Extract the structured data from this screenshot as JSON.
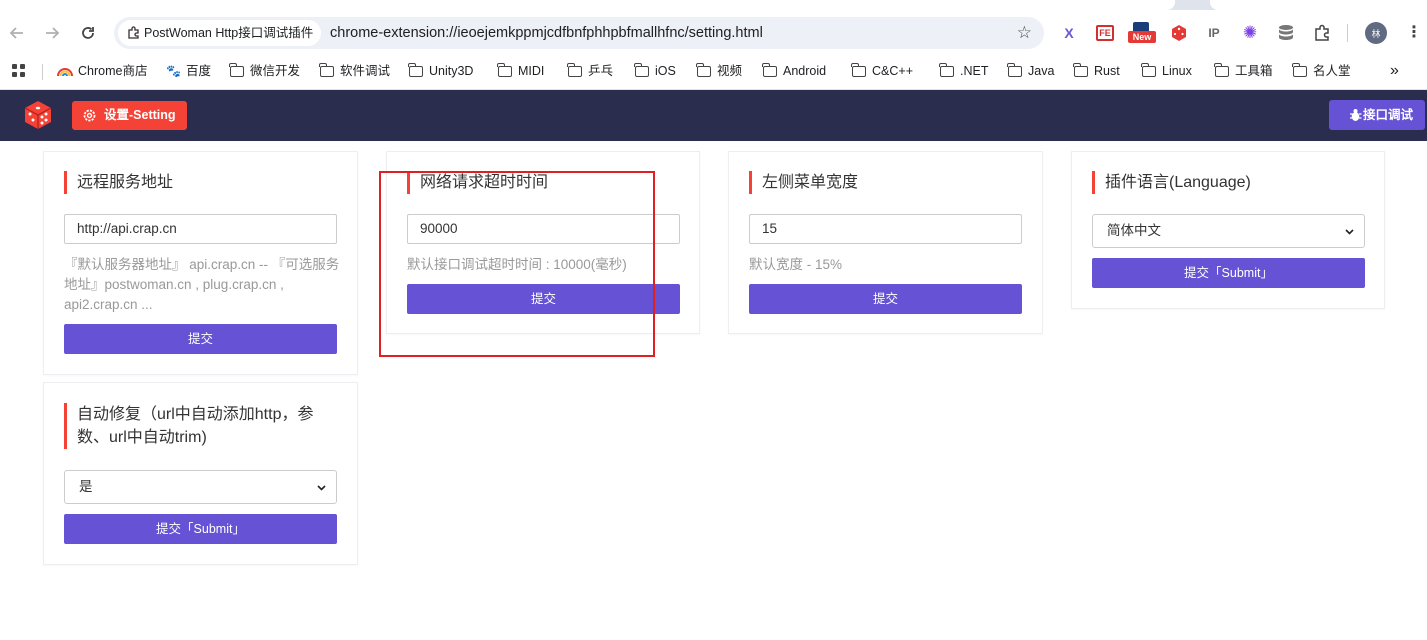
{
  "browser": {
    "tab_title": "PostWoman Http接口调试插件",
    "url": "chrome-extension://ieoejemkppmjcdfbnfphhpbfmallhfnc/setting.html",
    "extensions": [
      "x-icon",
      "fe-icon",
      "new-badge-icon",
      "dice-icon",
      "ip-icon",
      "flower-icon",
      "database-icon",
      "puzzle-icon"
    ],
    "extension_labels": {
      "fe": "FE",
      "new": "New",
      "ip": "IP",
      "x": "X"
    },
    "profile_initial": "林"
  },
  "bookmarks": [
    {
      "label": "Chrome商店",
      "type": "rainbow"
    },
    {
      "label": "百度",
      "type": "paw"
    },
    {
      "label": "微信开发",
      "type": "folder"
    },
    {
      "label": "软件调试",
      "type": "folder"
    },
    {
      "label": "Unity3D",
      "type": "folder"
    },
    {
      "label": "MIDI",
      "type": "folder"
    },
    {
      "label": "乒乓",
      "type": "folder"
    },
    {
      "label": "iOS",
      "type": "folder"
    },
    {
      "label": "视频",
      "type": "folder"
    },
    {
      "label": "Android",
      "type": "folder"
    },
    {
      "label": "C&C++",
      "type": "folder"
    },
    {
      "label": ".NET",
      "type": "folder"
    },
    {
      "label": "Java",
      "type": "folder"
    },
    {
      "label": "Rust",
      "type": "folder"
    },
    {
      "label": "Linux",
      "type": "folder"
    },
    {
      "label": "工具箱",
      "type": "folder"
    },
    {
      "label": "名人堂",
      "type": "folder"
    }
  ],
  "header": {
    "setting_label": "设置-Setting",
    "api_debug_label": "接口调试"
  },
  "cards": {
    "server": {
      "title": "远程服务地址",
      "value": "http://api.crap.cn",
      "hint": "『默认服务器地址』 api.crap.cn -- 『可选服务地址』postwoman.cn , plug.crap.cn , api2.crap.cn ...",
      "submit": "提交"
    },
    "timeout": {
      "title": "网络请求超时时间",
      "value": "90000",
      "hint": "默认接口调试超时时间 : 10000(毫秒)",
      "submit": "提交"
    },
    "menu_width": {
      "title": "左侧菜单宽度",
      "value": "15",
      "hint": "默认宽度 - 15%",
      "submit": "提交"
    },
    "language": {
      "title": "插件语言(Language)",
      "selected": "简体中文",
      "submit": "提交「Submit」"
    },
    "autofix": {
      "title": "自动修复（url中自动添加http，参数、url中自动trim)",
      "selected": "是",
      "submit": "提交「Submit」"
    }
  },
  "colors": {
    "header_bg": "#2a2d4d",
    "accent_red": "#f44336",
    "accent_purple": "#6552d4",
    "highlight_box": "#e02020"
  }
}
